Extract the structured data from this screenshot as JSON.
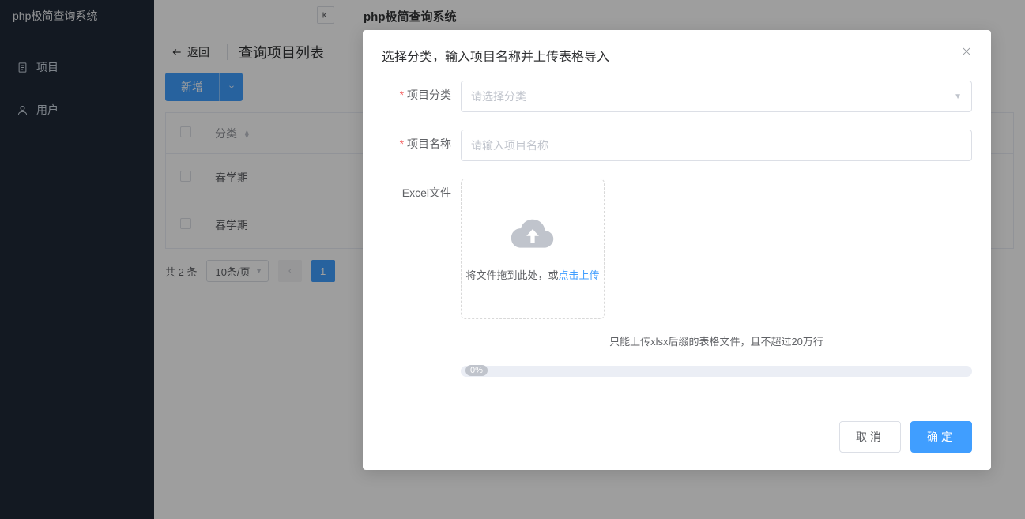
{
  "app": {
    "title": "php极简查询系统"
  },
  "sidebar": {
    "items": [
      {
        "label": "项目",
        "icon": "document-icon"
      },
      {
        "label": "用户",
        "icon": "user-icon"
      }
    ]
  },
  "page": {
    "back_label": "返回",
    "subtitle": "查询项目列表",
    "add_button": "新增"
  },
  "table": {
    "columns": {
      "category": "分类"
    },
    "rows": [
      {
        "category": "春学期"
      },
      {
        "category": "春学期"
      }
    ]
  },
  "pagination": {
    "total_text": "共 2 条",
    "page_size": "10条/页",
    "current": "1"
  },
  "dialog": {
    "title": "选择分类，输入项目名称并上传表格导入",
    "fields": {
      "category_label": "项目分类",
      "category_placeholder": "请选择分类",
      "name_label": "项目名称",
      "name_placeholder": "请输入项目名称",
      "file_label": "Excel文件"
    },
    "upload": {
      "drag_text": "将文件拖到此处，或",
      "link_text": "点击上传"
    },
    "tip": "只能上传xlsx后缀的表格文件，且不超过20万行",
    "progress": "0%",
    "cancel": "取消",
    "confirm": "确定"
  }
}
